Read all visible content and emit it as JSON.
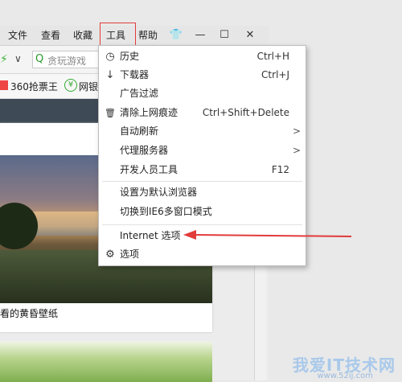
{
  "menubar": {
    "items": [
      "文件",
      "查看",
      "收藏",
      "工具",
      "帮助"
    ],
    "window_buttons": [
      "👕",
      "—",
      "☐",
      "✕"
    ]
  },
  "addressbar": {
    "search_placeholder": "贪玩游戏"
  },
  "favorites": {
    "items": [
      "360抢票王",
      "网银"
    ]
  },
  "content": {
    "caption": "看的黄昏壁纸"
  },
  "tools_menu": {
    "items": [
      {
        "icon": "clock-icon",
        "glyph": "◷",
        "label": "历史",
        "shortcut": "Ctrl+H"
      },
      {
        "icon": "download-icon",
        "glyph": "↓",
        "label": "下载器",
        "shortcut": "Ctrl+J"
      },
      {
        "icon": "",
        "glyph": "",
        "label": "广告过滤",
        "shortcut": ""
      },
      {
        "icon": "trash-icon",
        "glyph": "🗑",
        "label": "清除上网痕迹",
        "shortcut": "Ctrl+Shift+Delete"
      },
      {
        "icon": "",
        "glyph": "",
        "label": "自动刷新",
        "shortcut": "",
        "submenu": true
      },
      {
        "icon": "",
        "glyph": "",
        "label": "代理服务器",
        "shortcut": "",
        "submenu": true
      },
      {
        "icon": "",
        "glyph": "",
        "label": "开发人员工具",
        "shortcut": "F12"
      },
      {
        "icon": "",
        "glyph": "",
        "label": "设置为默认浏览器",
        "shortcut": ""
      },
      {
        "icon": "",
        "glyph": "",
        "label": "切换到IE6多窗口模式",
        "shortcut": ""
      },
      {
        "icon": "",
        "glyph": "",
        "label": "Internet 选项",
        "shortcut": ""
      },
      {
        "icon": "gear-icon",
        "glyph": "⚙",
        "label": "选项",
        "shortcut": ""
      }
    ]
  },
  "watermark": {
    "text": "我爱IT技术网",
    "url": "www.52ij.com"
  },
  "colors": {
    "annotation_red": "#e23b3b",
    "watermark_blue": "#a9c9ea"
  }
}
